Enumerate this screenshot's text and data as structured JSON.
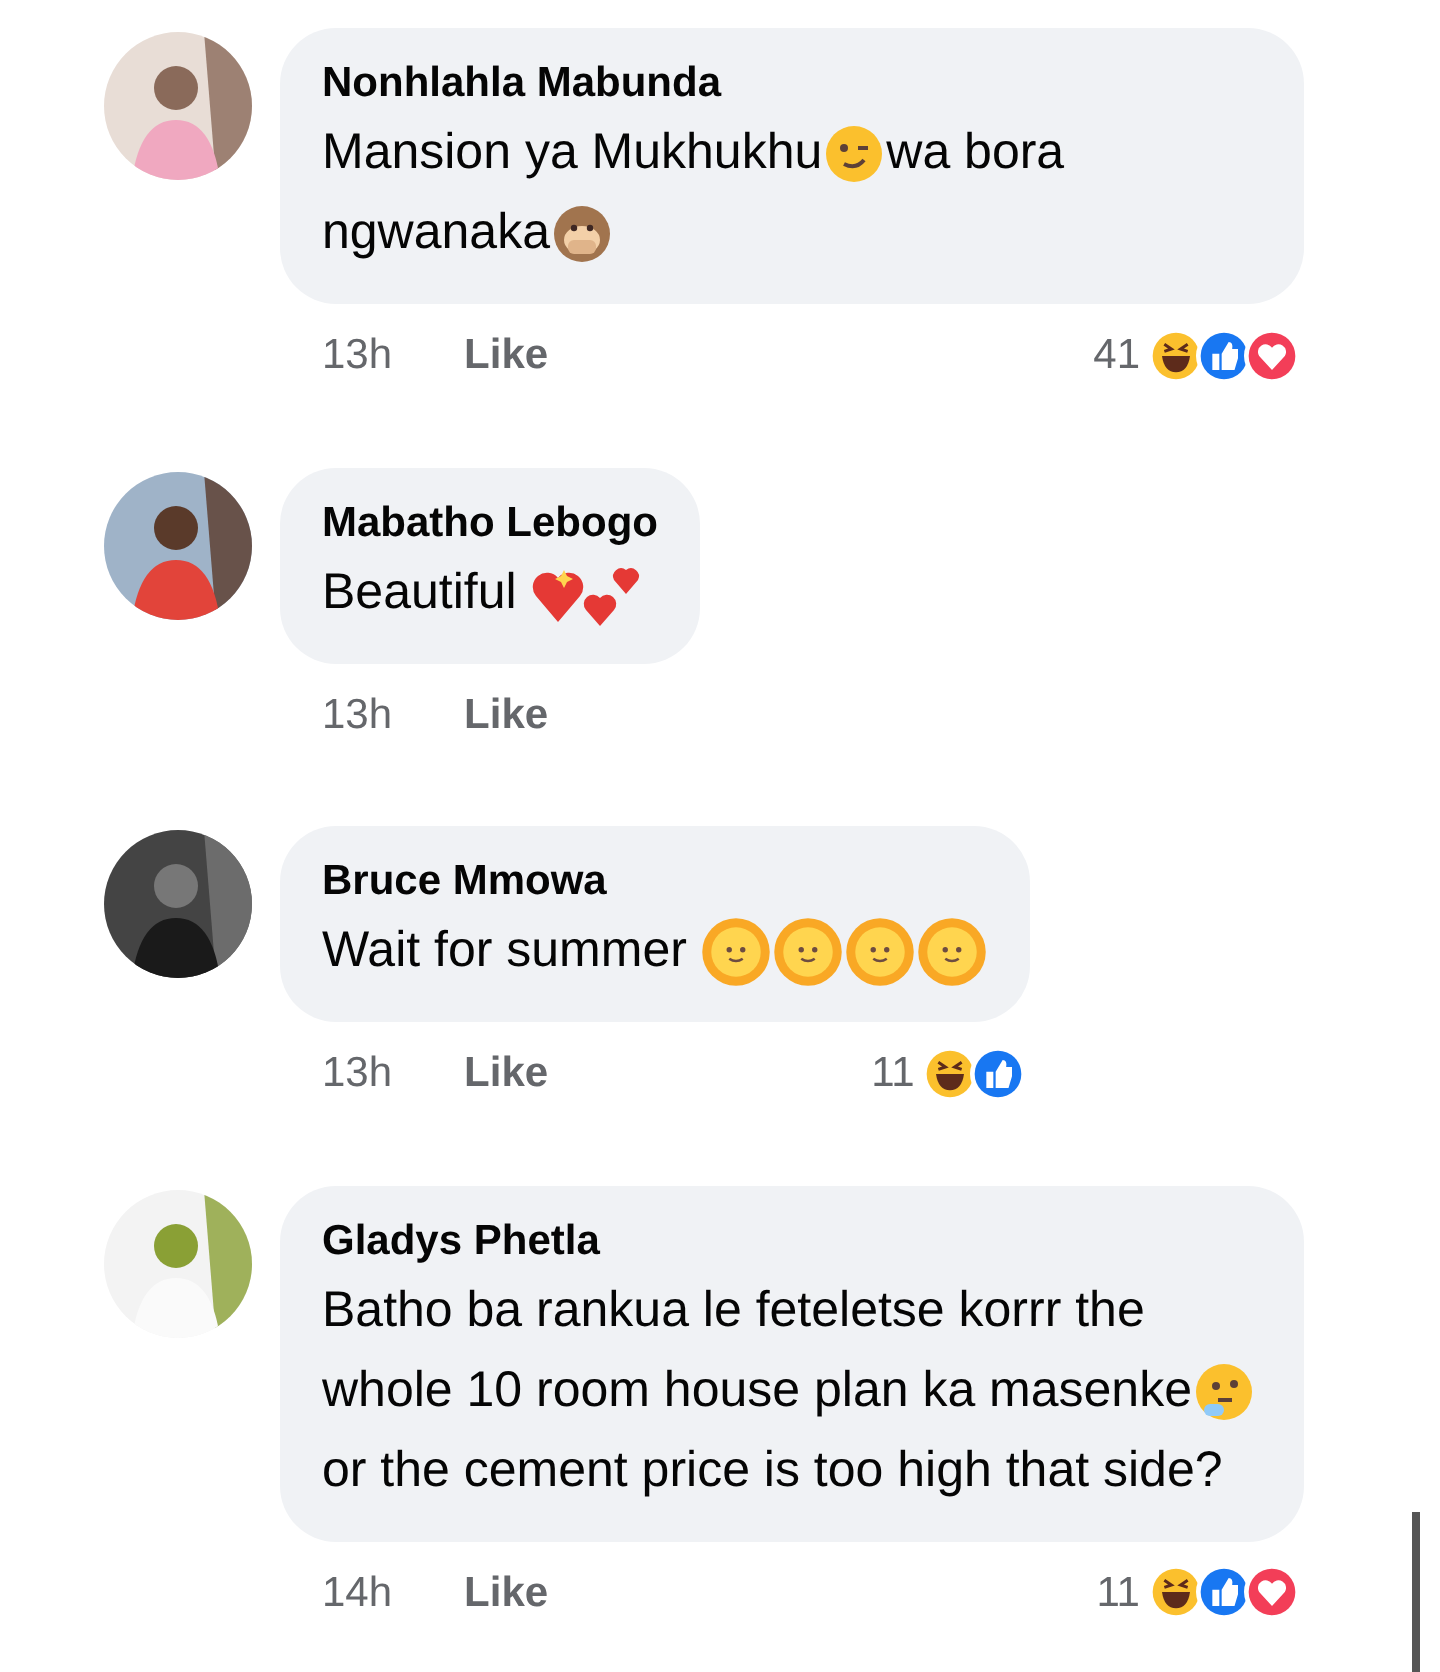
{
  "comments": [
    {
      "name": "Nonhlahla Mabunda",
      "avatar": {
        "kind": "picture"
      },
      "body": [
        {
          "kind": "text",
          "text": "Mansion ya Mukhukhu"
        },
        {
          "kind": "wink"
        },
        {
          "kind": "text",
          "text": "wa bora ngwanaka"
        },
        {
          "kind": "monkey"
        }
      ],
      "time": "13h",
      "like": "Like",
      "count": "41",
      "reactions": [
        {
          "kind": "haha"
        },
        {
          "kind": "like"
        },
        {
          "kind": "love"
        }
      ]
    },
    {
      "name": "Mabatho Lebogo",
      "avatar": {
        "kind": "picture"
      },
      "body": [
        {
          "kind": "text",
          "text": "Beautiful "
        },
        {
          "kind": "hearts"
        }
      ],
      "time": "13h",
      "like": "Like"
    },
    {
      "name": "Bruce Mmowa",
      "avatar": {
        "kind": "picture"
      },
      "body": [
        {
          "kind": "text",
          "text": "Wait for summer "
        },
        {
          "kind": "sun"
        },
        {
          "kind": "sun"
        },
        {
          "kind": "sun"
        },
        {
          "kind": "sun"
        }
      ],
      "time": "13h",
      "like": "Like",
      "count": "11",
      "reactions": [
        {
          "kind": "haha"
        },
        {
          "kind": "like"
        }
      ]
    },
    {
      "name": "Gladys Phetla",
      "avatar": {
        "kind": "picture"
      },
      "body": [
        {
          "kind": "text",
          "text": "Batho ba rankua le feteletse korrr the whole 10 room house plan ka masenke"
        },
        {
          "kind": "thinking"
        },
        {
          "kind": "text",
          "text": " or the cement price is too high that side?"
        }
      ],
      "time": "14h",
      "like": "Like",
      "count": "11",
      "reactions": [
        {
          "kind": "haha"
        },
        {
          "kind": "like"
        },
        {
          "kind": "love"
        }
      ]
    }
  ]
}
